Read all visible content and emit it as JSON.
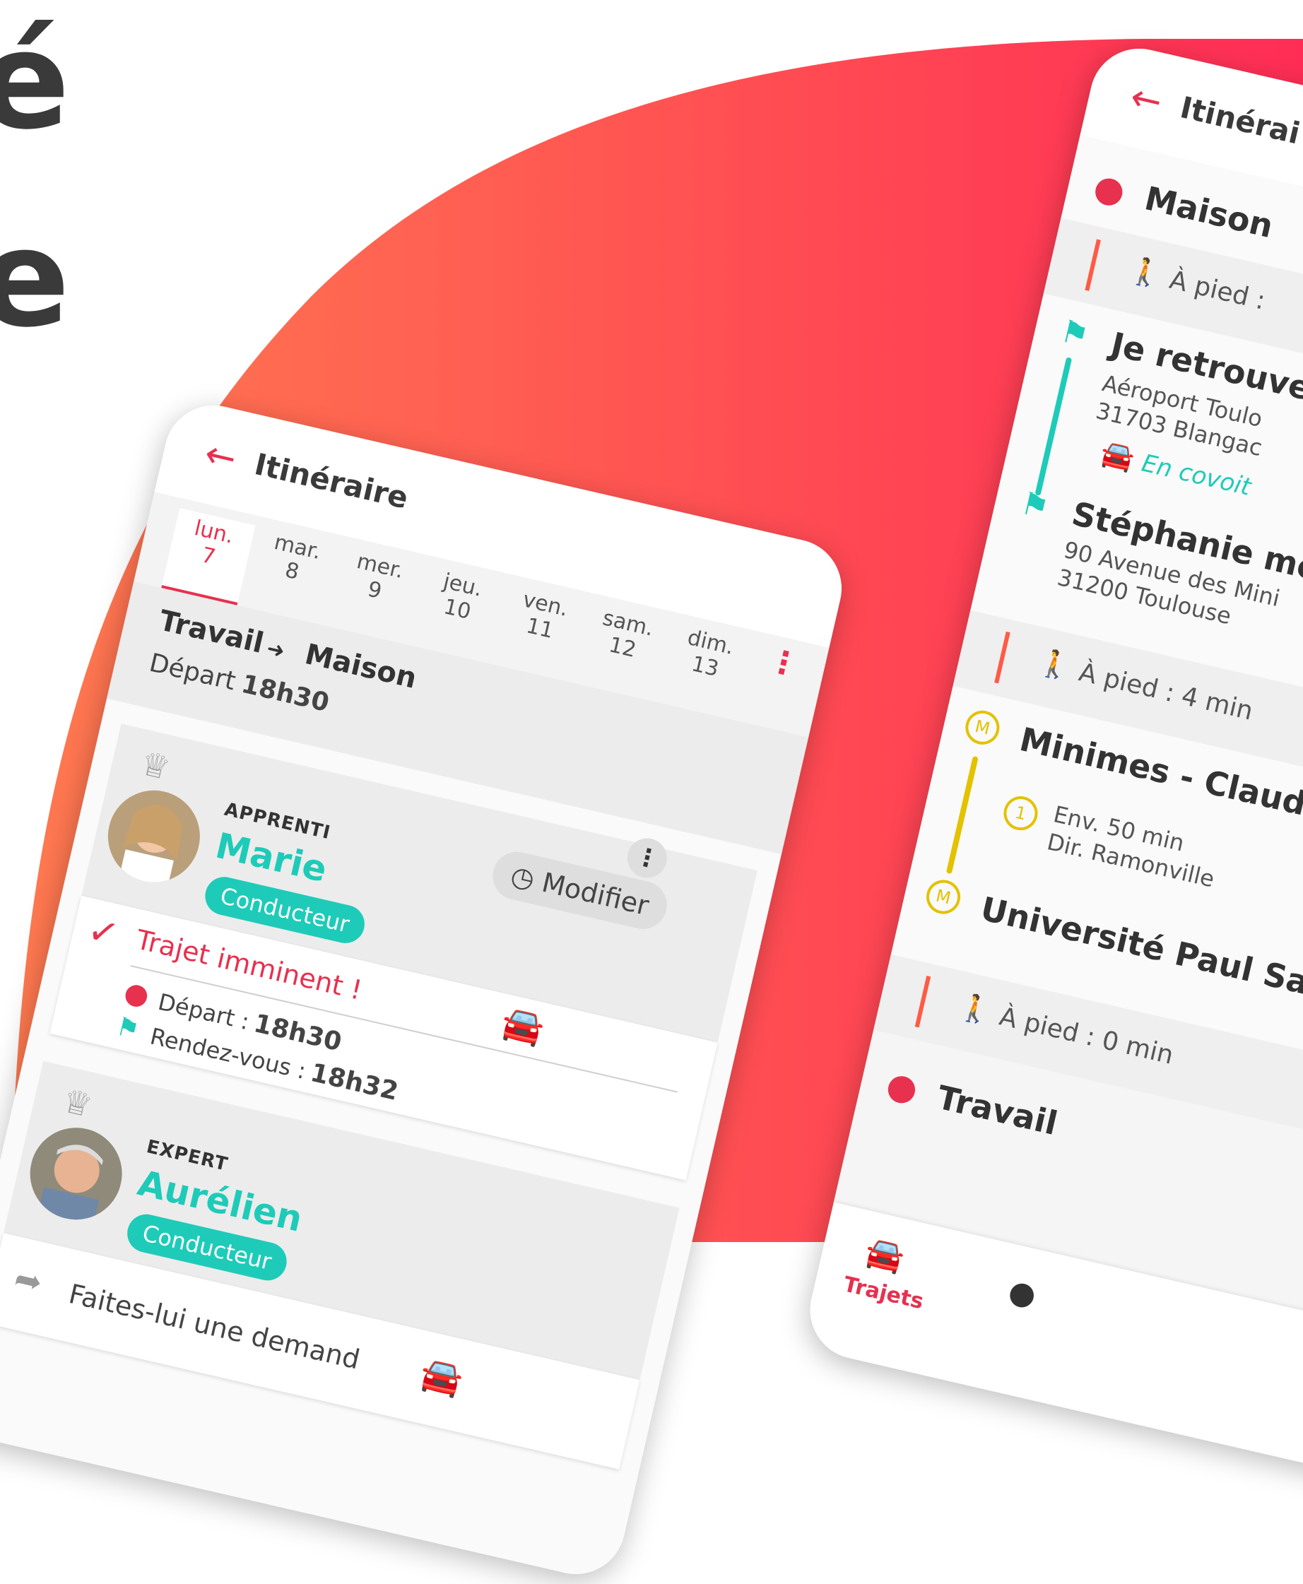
{
  "headline": {
    "line1": "é",
    "line2": "e"
  },
  "left_phone": {
    "title": "Itinéraire",
    "days": [
      {
        "name": "lun.",
        "num": "7"
      },
      {
        "name": "mar.",
        "num": "8"
      },
      {
        "name": "mer.",
        "num": "9"
      },
      {
        "name": "jeu.",
        "num": "10"
      },
      {
        "name": "ven.",
        "num": "11"
      },
      {
        "name": "sam.",
        "num": "12"
      },
      {
        "name": "dim.",
        "num": "13"
      }
    ],
    "route": {
      "from": "Travail",
      "to": "Maison",
      "depart_label": "Départ",
      "depart_time": "18h30"
    },
    "modify_label": "Modifier",
    "card1": {
      "rank": "APPRENTI",
      "name": "Marie",
      "role": "Conducteur",
      "status": "Trajet imminent !",
      "depart_label": "Départ :",
      "depart_time": "18h30",
      "meet_label": "Rendez-vous :",
      "meet_time": "18h32"
    },
    "card2": {
      "rank": "EXPERT",
      "name": "Aurélien",
      "role": "Conducteur",
      "request": "Faites-lui une demand"
    }
  },
  "right_phone": {
    "title": "Itinérai",
    "start": "Maison",
    "walk1": "À pied :",
    "meet": {
      "title": "Je retrouve",
      "addr1": "Aéroport Toulo",
      "addr2": "31703 Blangac",
      "mode": "En covoit"
    },
    "drop": {
      "title": "Stéphanie me",
      "addr1": "90 Avenue des Mini",
      "addr2": "31200 Toulouse"
    },
    "walk2": "À pied : 4 min",
    "metro_from": "Minimes - Claude",
    "metro_line": "1",
    "metro_letter": "M",
    "metro_dur": "Env. 50 min",
    "metro_dir": "Dir. Ramonville",
    "metro_to": "Université Paul Saba",
    "walk3": "À pied : 0 min",
    "end": "Travail",
    "tab_label": "Trajets"
  },
  "colors": {
    "accent_red": "#e8304f",
    "teal": "#1ecbb8",
    "metro_yellow": "#e3c200",
    "gradient_start": "#ff7a50",
    "gradient_end": "#ff2d55"
  }
}
